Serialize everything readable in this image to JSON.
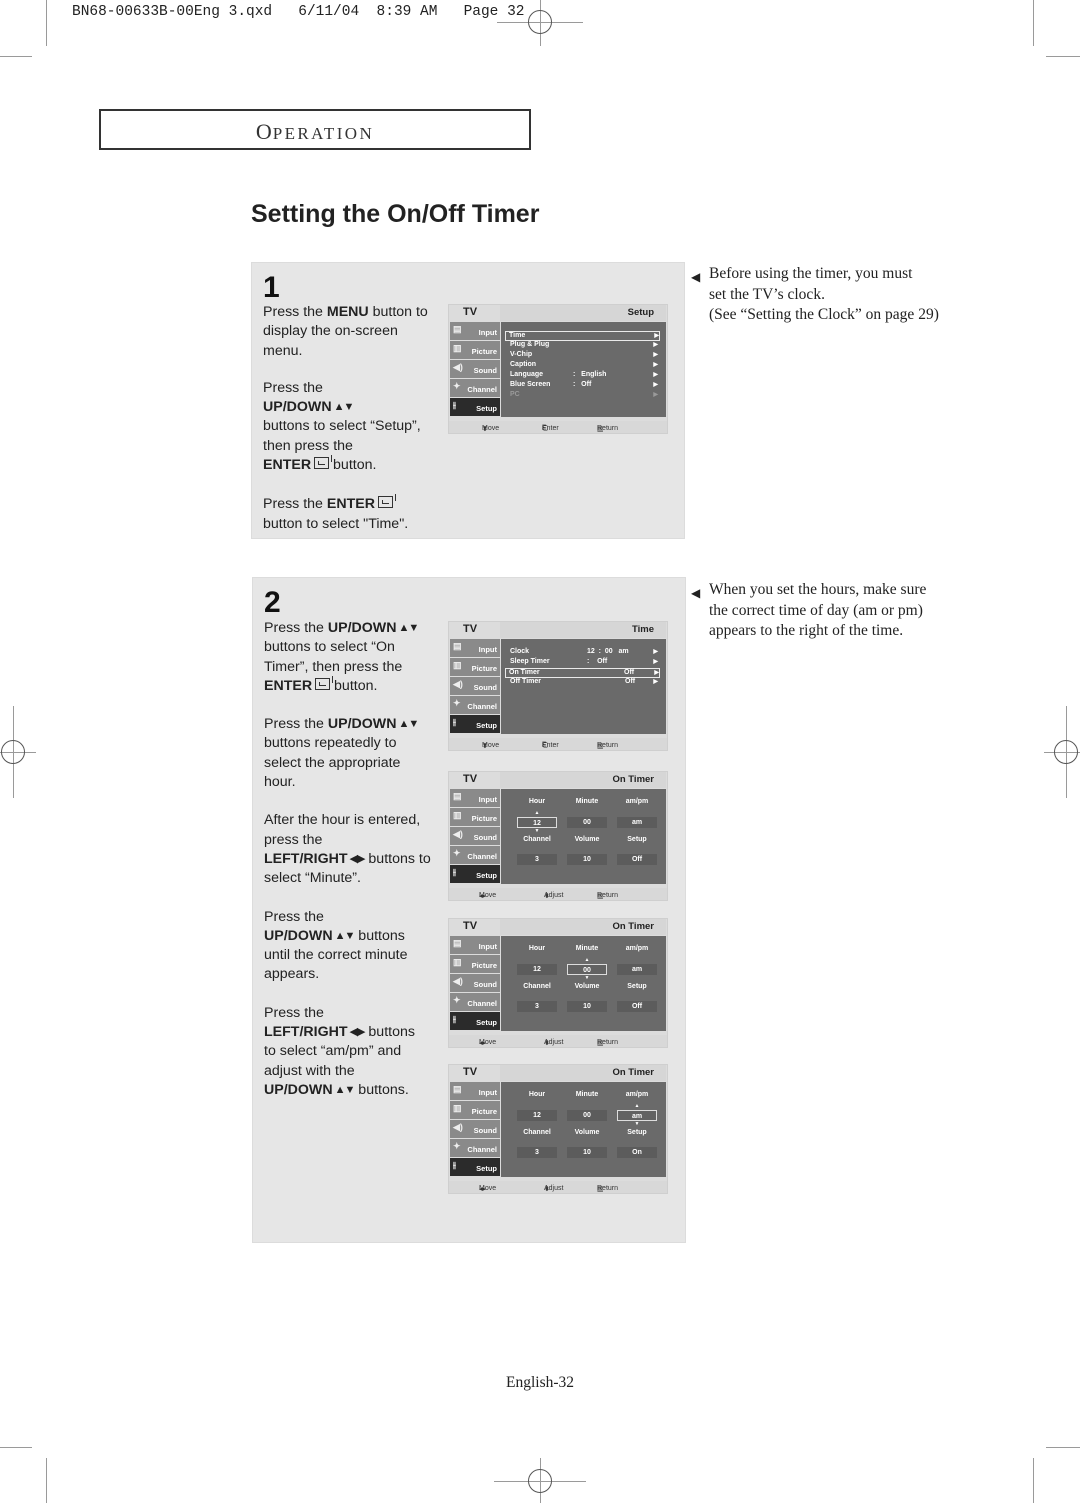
{
  "slug": "BN68-00633B-00Eng 3.qxd   6/11/04  8:39 AM   Page 32",
  "section": {
    "first_letter": "O",
    "rest": "PERATION"
  },
  "page_title": "Setting the On/Off Timer",
  "step1": {
    "number": "1",
    "paragraphs": [
      {
        "pre": "Press the ",
        "bold": "MENU",
        "post": " button to display the on-screen menu."
      },
      {
        "pre": "Press the",
        "bold": "UP/DOWN",
        "arrows": "▲▼",
        "post": "buttons to select “Setup”, then press the",
        "bold2": "ENTER",
        "post2": " button."
      },
      {
        "pre": "Press the ",
        "bold": "ENTER",
        "post": "button to select \"Time\"."
      }
    ],
    "osd": {
      "tv_label": "TV",
      "title": "Setup",
      "sidebar": [
        "Input",
        "Picture",
        "Sound",
        "Channel",
        "Setup"
      ],
      "selected_sidebar": "Setup",
      "rows": [
        {
          "label": "Time",
          "value": "",
          "highlight": true
        },
        {
          "label": "Plug & Plug",
          "value": ""
        },
        {
          "label": "V-Chip",
          "value": ""
        },
        {
          "label": "Caption",
          "value": ""
        },
        {
          "label": "Language",
          "value": ":   English"
        },
        {
          "label": "Blue Screen",
          "value": ":   Off"
        },
        {
          "label": "PC",
          "value": "",
          "dim": true
        }
      ],
      "footer": [
        "Move",
        "Enter",
        "Return"
      ]
    }
  },
  "step2": {
    "number": "2",
    "p1": {
      "pre": "Press the ",
      "bold": "UP/DOWN",
      "arrows": "▲▼",
      "post": "buttons to select “On Timer”, then press the",
      "bold2": "ENTER",
      "post2": " button."
    },
    "p2": {
      "pre": "Press the ",
      "bold": "UP/DOWN",
      "arrows": "▲▼",
      "post": "buttons repeatedly to select the appropriate hour."
    },
    "p3": {
      "pre": "After the hour is entered, press the",
      "bold": "LEFT/RIGHT",
      "arrows": "◀▶",
      "post": " buttons to select “Minute”."
    },
    "p4": {
      "pre": "Press the",
      "bold": "UP/DOWN",
      "arrows": "▲▼",
      "post": " buttons until the correct minute appears."
    },
    "p5": {
      "pre": "Press the",
      "bold": "LEFT/RIGHT",
      "arrows": "◀▶",
      "post": " buttons to select “am/pm” and adjust with the",
      "bold2": "UP/DOWN",
      "arrows2": "▲▼",
      "post2": " buttons."
    },
    "osd_time": {
      "tv_label": "TV",
      "title": "Time",
      "sidebar": [
        "Input",
        "Picture",
        "Sound",
        "Channel",
        "Setup"
      ],
      "rows": [
        {
          "label": "Clock",
          "value": "12  :  00   am"
        },
        {
          "label": "Sleep Timer",
          "value": ":    Off"
        },
        {
          "label": "On Timer",
          "value": "Off",
          "highlight": true
        },
        {
          "label": "Off Timer",
          "value": "Off"
        }
      ],
      "footer": [
        "Move",
        "Enter",
        "Return"
      ]
    },
    "osd_ontimer": [
      {
        "tv_label": "TV",
        "title": "On Timer",
        "sidebar": [
          "Input",
          "Picture",
          "Sound",
          "Channel",
          "Setup"
        ],
        "labels_top": [
          "Hour",
          "Minute",
          "am/pm"
        ],
        "values_top": [
          "12",
          "00",
          "am"
        ],
        "labels_bottom": [
          "Channel",
          "Volume",
          "Setup"
        ],
        "values_bottom": [
          "3",
          "10",
          "Off"
        ],
        "active": "Hour",
        "footer": [
          "Move",
          "Adjust",
          "Return"
        ]
      },
      {
        "tv_label": "TV",
        "title": "On Timer",
        "sidebar": [
          "Input",
          "Picture",
          "Sound",
          "Channel",
          "Setup"
        ],
        "labels_top": [
          "Hour",
          "Minute",
          "am/pm"
        ],
        "values_top": [
          "12",
          "00",
          "am"
        ],
        "labels_bottom": [
          "Channel",
          "Volume",
          "Setup"
        ],
        "values_bottom": [
          "3",
          "10",
          "Off"
        ],
        "active": "Minute",
        "footer": [
          "Move",
          "Adjust",
          "Return"
        ]
      },
      {
        "tv_label": "TV",
        "title": "On Timer",
        "sidebar": [
          "Input",
          "Picture",
          "Sound",
          "Channel",
          "Setup"
        ],
        "labels_top": [
          "Hour",
          "Minute",
          "am/pm"
        ],
        "values_top": [
          "12",
          "00",
          "am"
        ],
        "labels_bottom": [
          "Channel",
          "Volume",
          "Setup"
        ],
        "values_bottom": [
          "3",
          "10",
          "On"
        ],
        "active": "am/pm",
        "footer": [
          "Move",
          "Adjust",
          "Return"
        ]
      }
    ]
  },
  "notes": [
    "Before using the timer, you must set the TV’s clock. (See “Setting the Clock” on page 29)",
    "When you set the hours, make sure the correct time of day (am or pm) appears to the right of the time."
  ],
  "notes_lines": [
    [
      "Before using the timer, you must",
      "set the TV’s clock.",
      "(See “Setting the Clock” on page 29)"
    ],
    [
      "When you set the hours, make sure",
      "the correct time of day (am or pm)",
      "appears to the right of the time."
    ]
  ],
  "footer_page": "English-32",
  "icons": {
    "note_marker": "◀",
    "sidebar": [
      "input-icon",
      "picture-icon",
      "sound-icon",
      "channel-icon",
      "setup-icon"
    ]
  }
}
